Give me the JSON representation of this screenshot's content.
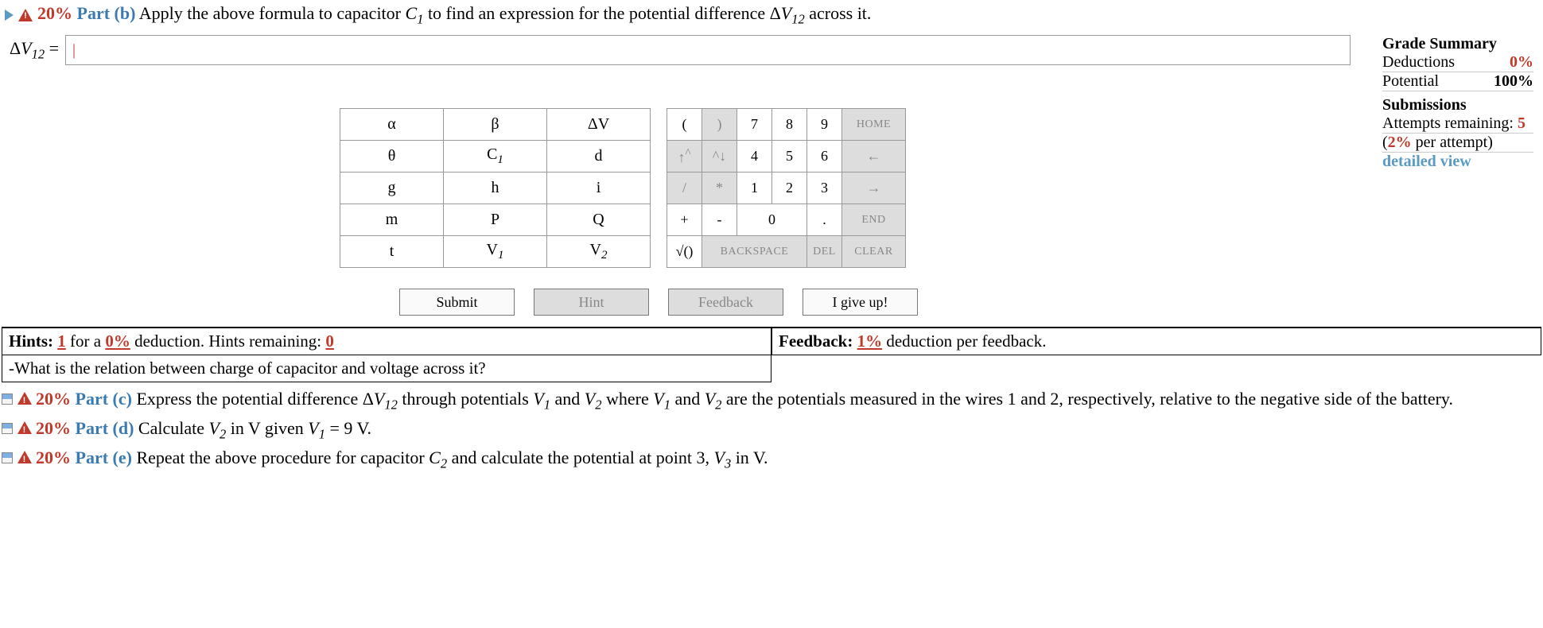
{
  "partB": {
    "percent": "20%",
    "label": "Part (b)",
    "text_before": "Apply the above formula to capacitor ",
    "text_cap": "C",
    "text_sub": "1",
    "text_mid": " to find an expression for the potential difference Δ",
    "text_v": "V",
    "text_vsub": "12",
    "text_after": " across it."
  },
  "equation": {
    "lhs_delta": "Δ",
    "lhs_v": "V",
    "lhs_sub": "12",
    "equals": " = ",
    "input_value": "|"
  },
  "grade": {
    "title": "Grade Summary",
    "deductions_label": "Deductions",
    "deductions_value": "0%",
    "potential_label": "Potential",
    "potential_value": "100%"
  },
  "submissions": {
    "title": "Submissions",
    "attempts_label": "Attempts remaining: ",
    "attempts_value": "5",
    "per_attempt_before": "(",
    "per_attempt_pct": "2%",
    "per_attempt_after": " per attempt)",
    "detailed": "detailed view"
  },
  "symkeys": {
    "r0c0": "α",
    "r0c1": "β",
    "r0c2": "ΔV",
    "r1c0": "θ",
    "r1c1_c": "C",
    "r1c1_s": "1",
    "r1c2": "d",
    "r2c0": "g",
    "r2c1": "h",
    "r2c2": "i",
    "r3c0": "m",
    "r3c1": "P",
    "r3c2": "Q",
    "r4c0": "t",
    "r4c1_v": "V",
    "r4c1_s": "1",
    "r4c2_v": "V",
    "r4c2_s": "2"
  },
  "numpad": {
    "lp": "(",
    "rp": ")",
    "n7": "7",
    "n8": "8",
    "n9": "9",
    "home": "HOME",
    "up": "↑",
    "sup": "^",
    "down": "^↓",
    "n4": "4",
    "n5": "5",
    "n6": "6",
    "left": "←",
    "slash": "/",
    "star": "*",
    "n1": "1",
    "n2": "2",
    "n3": "3",
    "right": "→",
    "plus": "+",
    "minus": "-",
    "n0": "0",
    "dot": ".",
    "end": "END",
    "sqrt": "√()",
    "backspace": "BACKSPACE",
    "del": "DEL",
    "clear": "CLEAR"
  },
  "actions": {
    "submit": "Submit",
    "hint": "Hint",
    "feedback": "Feedback",
    "giveup": "I give up!"
  },
  "hints": {
    "label": "Hints:",
    "count": "1",
    "for": " for a ",
    "pct": "0%",
    "deduction": " deduction. Hints remaining: ",
    "remaining": "0",
    "body": "-What is the relation between charge of capacitor and voltage across it?"
  },
  "feedback": {
    "label": "Feedback:",
    "pct": "1%",
    "text": " deduction per feedback."
  },
  "partC": {
    "percent": "20%",
    "label": "Part (c)",
    "text": "Express the potential difference ΔV₁₂ through potentials V₁ and V₂ where V₁ and V₂ are the potentials measured in the wires 1 and 2, respectively, relative to the negative side of the battery."
  },
  "partD": {
    "percent": "20%",
    "label": "Part (d)",
    "text": "Calculate V₂ in V given V₁ = 9 V."
  },
  "partE": {
    "percent": "20%",
    "label": "Part (e)",
    "text": "Repeat the above procedure for capacitor C₂ and calculate the potential at point 3, V₃ in V."
  }
}
